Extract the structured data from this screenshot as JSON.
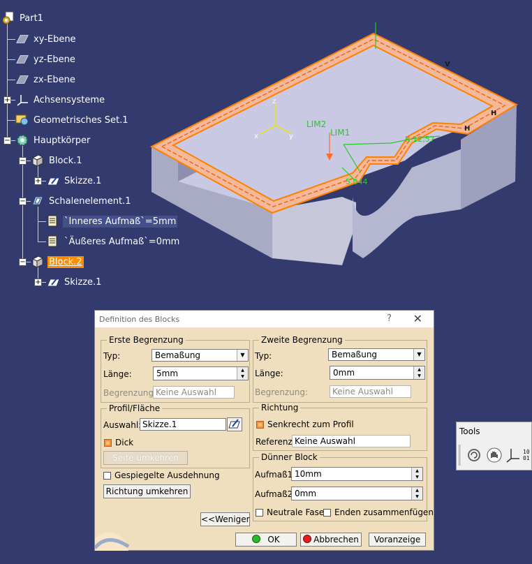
{
  "tree": {
    "root": "Part1",
    "xy": "xy-Ebene",
    "yz": "yz-Ebene",
    "zx": "zx-Ebene",
    "axes": "Achsensysteme",
    "geoset": "Geometrisches Set.1",
    "body": "Hauptkörper",
    "block1": "Block.1",
    "sketch1": "Skizze.1",
    "shell": "Schalenelement.1",
    "inner": "`Inneres Aufmaß`=5mm",
    "outer": "`Äußeres Aufmaß`=0mm",
    "block2": "Block.2",
    "sketch2": "Skizze.1"
  },
  "scene": {
    "lim2": "LIM2",
    "lim1": "LIM1",
    "r_dim": "R 12,57",
    "dim2": "5,044",
    "axis_z": "z",
    "axis_x": "x",
    "axis_y": "y",
    "letter_h1": "H",
    "letter_h2": "H",
    "letter_v": "V"
  },
  "dialog": {
    "title": "Definition des Blocks",
    "help": "?",
    "close": "✕",
    "first": {
      "legend": "Erste Begrenzung",
      "type_label": "Typ:",
      "type_value": "Bemaßung",
      "length_label": "Länge:",
      "length_value": "5mm",
      "limit_label": "Begrenzung:",
      "limit_value": "Keine Auswahl"
    },
    "second": {
      "legend": "Zweite Begrenzung",
      "type_label": "Typ:",
      "type_value": "Bemaßung",
      "length_label": "Länge:",
      "length_value": "0mm",
      "limit_label": "Begrenzung:",
      "limit_value": "Keine Auswahl"
    },
    "profile": {
      "legend": "Profil/Fläche",
      "select_label": "Auswahl:",
      "select_value": "Skizze.1",
      "thick_label": "Dick",
      "reverse_side": "Seite umkehren"
    },
    "direction": {
      "legend": "Richtung",
      "normal_label": "Senkrecht zum Profil",
      "ref_label": "Referenz:",
      "ref_value": "Keine Auswahl"
    },
    "thin": {
      "legend": "Dünner Block",
      "t1_label": "Aufmaß1:",
      "t1_value": "10mm",
      "t2_label": "Aufmaß2:",
      "t2_value": "0mm",
      "neutral_label": "Neutrale Faser",
      "merge_label": "Enden zusammenfügen"
    },
    "mirror_label": "Gespiegelte Ausdehnung",
    "reverse_dir": "Richtung umkehren",
    "less": "<<Weniger",
    "ok": "OK",
    "cancel": "Abbrechen",
    "preview": "Voranzeige"
  },
  "tools": {
    "title": "Tools"
  },
  "colors": {
    "background": "#323a6e",
    "dialog": "#f0dfbf",
    "highlight": "#ff8c00",
    "dimension": "#22cc22"
  }
}
